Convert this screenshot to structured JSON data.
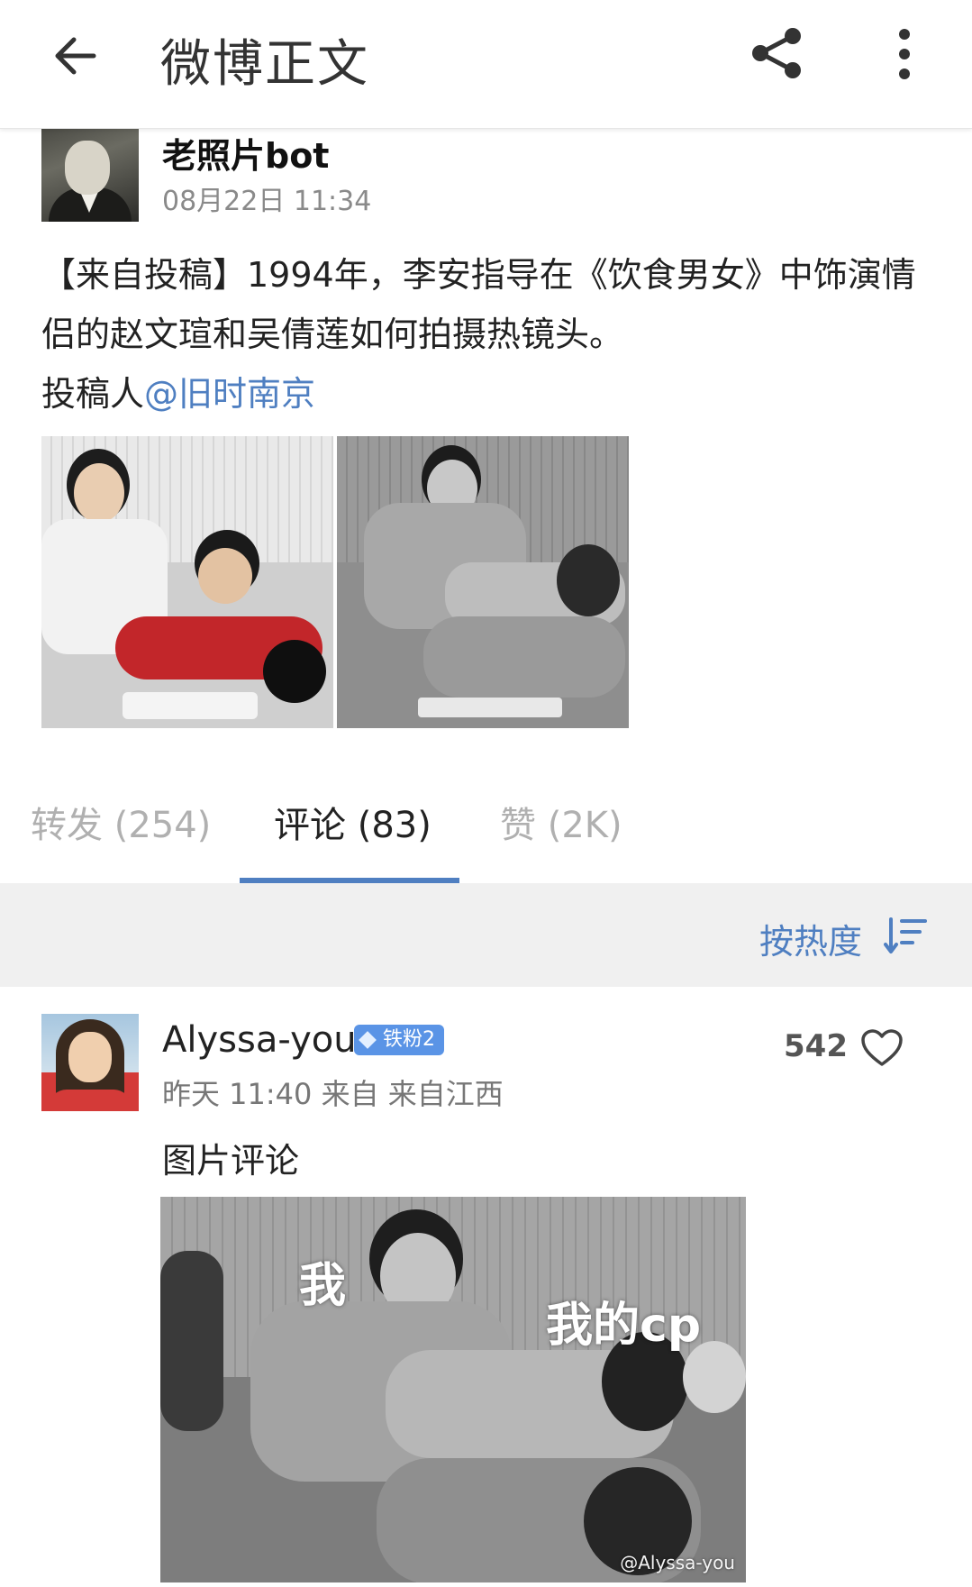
{
  "header": {
    "title": "微博正文"
  },
  "post": {
    "username": "老照片bot",
    "time": "08月22日 11:34",
    "text_main": "【来自投稿】1994年，李安指导在《饮食男女》中饰演情侣的赵文瑄和吴倩莲如何拍摄热镜头。",
    "text_credit_prefix": "投稿人",
    "text_credit_mention": "@旧时南京"
  },
  "tabs": {
    "repost": "转发 (254)",
    "comment": "评论 (83)",
    "like": "赞 (2K)"
  },
  "sort": {
    "label": "按热度"
  },
  "comment": {
    "username": "Alyssa-you",
    "badge": "铁粉2",
    "meta": "昨天 11:40 来自 来自江西",
    "likes": "542",
    "text": "图片评论",
    "image_overlay_1": "我",
    "image_overlay_2": "我的cp",
    "image_watermark": "@Alyssa-you"
  },
  "colors": {
    "accent": "#4f7fc1",
    "badge": "#5a94e6"
  }
}
